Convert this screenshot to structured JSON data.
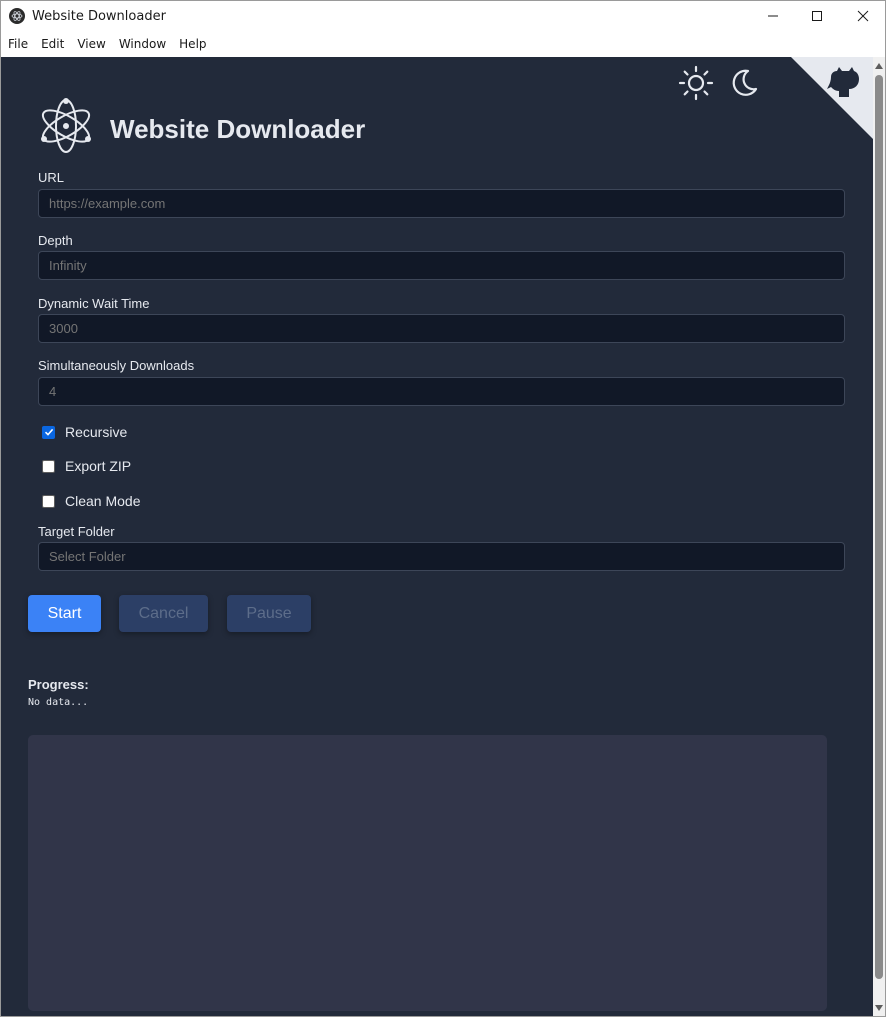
{
  "window": {
    "title": "Website Downloader",
    "minimize_icon": "minimize-icon",
    "maximize_icon": "maximize-icon",
    "close_icon": "close-icon"
  },
  "menu": [
    "File",
    "Edit",
    "View",
    "Window",
    "Help"
  ],
  "header": {
    "title": "Website Downloader",
    "light_theme_icon": "sun-icon",
    "dark_theme_icon": "moon-icon",
    "github_icon": "github-icon"
  },
  "form": {
    "url": {
      "label": "URL",
      "placeholder": "https://example.com"
    },
    "depth": {
      "label": "Depth",
      "placeholder": "Infinity"
    },
    "wait": {
      "label": "Dynamic Wait Time",
      "placeholder": "3000"
    },
    "simultaneous": {
      "label": "Simultaneously Downloads",
      "placeholder": "4"
    },
    "recursive": {
      "label": "Recursive",
      "checked": true
    },
    "export_zip": {
      "label": "Export ZIP",
      "checked": false
    },
    "clean_mode": {
      "label": "Clean Mode",
      "checked": false
    },
    "target": {
      "label": "Target Folder",
      "placeholder": "Select Folder"
    }
  },
  "buttons": {
    "start": "Start",
    "cancel": "Cancel",
    "pause": "Pause"
  },
  "progress": {
    "label": "Progress:",
    "text": "No data..."
  },
  "colors": {
    "background": "#222a3a",
    "input_bg": "#111827",
    "accent": "#3b82f6",
    "disabled_button": "#2c3f66",
    "log_bg": "#313549"
  }
}
